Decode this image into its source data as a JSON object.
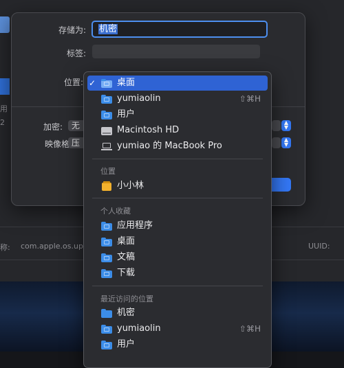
{
  "background": {
    "fragments": {
      "left_a": "用",
      "left_b": "2",
      "bottom_name_label": "称:",
      "bottom_id_value": "com.apple.os.upo",
      "bottom_uuid_label": "UUID:"
    }
  },
  "save_sheet": {
    "save_as_label": "存储为:",
    "save_as_value": "机密",
    "tags_label": "标签:",
    "location_label": "位置:",
    "encryption_label": "加密:",
    "encryption_value": "无",
    "image_format_label": "映像格式:",
    "image_format_value": "压缩"
  },
  "location_menu": {
    "devices": [
      {
        "label": "桌面",
        "icon": "desktop-folder-icon",
        "selected": true
      },
      {
        "label": "yumiaolin",
        "icon": "home-folder-icon",
        "shortcut": "⇧⌘H"
      },
      {
        "label": "用户",
        "icon": "users-folder-icon"
      },
      {
        "label": "Macintosh HD",
        "icon": "hard-drive-icon"
      },
      {
        "label": "yumiao 的 MacBook Pro",
        "icon": "laptop-icon"
      }
    ],
    "locations_header": "位置",
    "locations": [
      {
        "label": "小小林",
        "icon": "external-drive-icon"
      }
    ],
    "favorites_header": "个人收藏",
    "favorites": [
      {
        "label": "应用程序",
        "icon": "applications-folder-icon"
      },
      {
        "label": "桌面",
        "icon": "desktop-folder-icon"
      },
      {
        "label": "文稿",
        "icon": "documents-folder-icon"
      },
      {
        "label": "下载",
        "icon": "downloads-folder-icon"
      }
    ],
    "recents_header": "最近访问的位置",
    "recents": [
      {
        "label": "机密",
        "icon": "folder-icon"
      },
      {
        "label": "yumiaolin",
        "icon": "home-folder-icon",
        "shortcut": "⇧⌘H"
      },
      {
        "label": "用户",
        "icon": "users-folder-icon"
      }
    ],
    "checkmark": "✓"
  }
}
